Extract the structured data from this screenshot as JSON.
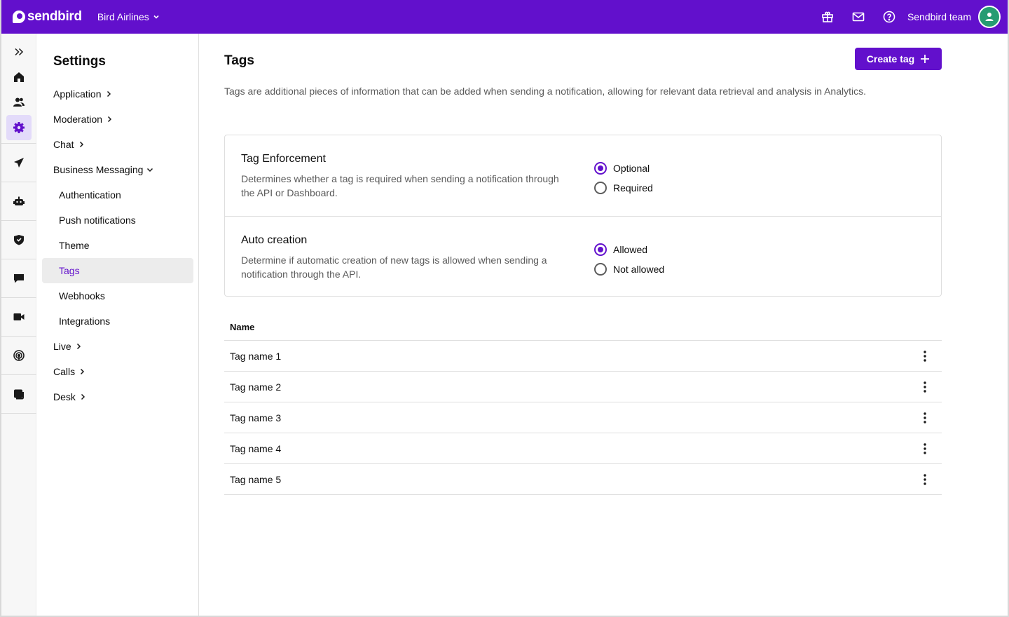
{
  "header": {
    "logo_text": "sendbird",
    "org_name": "Bird Airlines",
    "account_name": "Sendbird team",
    "brand_color": "#6210cc",
    "avatar_color": "#259c72",
    "icons": [
      "gift-icon",
      "mail-icon",
      "help-icon"
    ]
  },
  "rail": {
    "items": [
      "expand-icon",
      "home-icon",
      "users-icon",
      "settings-icon",
      "send-icon",
      "bot-icon",
      "heart-shield-icon",
      "chat-icon",
      "video-icon",
      "live-icon",
      "desk-icon"
    ],
    "active": "settings-icon"
  },
  "sidebar": {
    "title": "Settings",
    "items": [
      {
        "label": "Application"
      },
      {
        "label": "Moderation"
      },
      {
        "label": "Chat"
      },
      {
        "label": "Business Messaging"
      },
      {
        "label": "Authentication"
      },
      {
        "label": "Push notifications"
      },
      {
        "label": "Theme"
      },
      {
        "label": "Tags"
      },
      {
        "label": "Webhooks"
      },
      {
        "label": "Integrations"
      },
      {
        "label": "Live"
      },
      {
        "label": "Calls"
      },
      {
        "label": "Desk"
      }
    ],
    "active": "Tags"
  },
  "main": {
    "title": "Tags",
    "create_label": "Create tag",
    "description": "Tags are additional pieces of information that can be added when sending a notification, allowing for relevant data retrieval and analysis in Analytics.",
    "settings": [
      {
        "title": "Tag Enforcement",
        "description": "Determines whether a tag is required when sending a notification through the API or Dashboard.",
        "options": [
          "Optional",
          "Required"
        ],
        "selected": "Optional"
      },
      {
        "title": "Auto creation",
        "description": "Determine if automatic creation of new tags is allowed when sending a notification through the API.",
        "options": [
          "Allowed",
          "Not allowed"
        ],
        "selected": "Allowed"
      }
    ],
    "table": {
      "header": "Name",
      "rows": [
        "Tag name 1",
        "Tag name 2",
        "Tag name 3",
        "Tag name 4",
        "Tag name 5"
      ]
    }
  }
}
